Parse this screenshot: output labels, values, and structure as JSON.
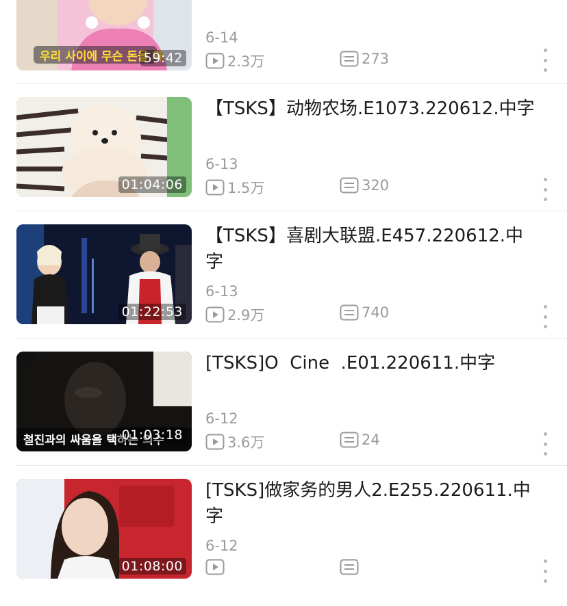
{
  "videos": [
    {
      "title": "",
      "date": "6-14",
      "views": "2.3万",
      "comments": "273",
      "duration": "59:42",
      "caption": "우리 사이에 무슨 돈을 와"
    },
    {
      "title": "【TSKS】动物农场.E1073.220612.中字",
      "date": "6-13",
      "views": "1.5万",
      "comments": "320",
      "duration": "01:04:06",
      "caption": ""
    },
    {
      "title": "【TSKS】喜剧大联盟.E457.220612.中字",
      "date": "6-13",
      "views": "2.9万",
      "comments": "740",
      "duration": "01:22:53",
      "caption": ""
    },
    {
      "title": "[TSKS]O  Cine  .E01.220611.中字",
      "date": "6-12",
      "views": "3.6万",
      "comments": "24",
      "duration": "01:03:18",
      "caption": "철진과의 싸움을 택하는 의수"
    },
    {
      "title": "[TSKS]做家务的男人2.E255.220611.中字",
      "date": "6-12",
      "views": "",
      "comments": "",
      "duration": "01:08:00",
      "caption": ""
    }
  ],
  "icons": {
    "views": "play-icon",
    "comments": "comment-icon",
    "more": "more-vertical-icon"
  }
}
